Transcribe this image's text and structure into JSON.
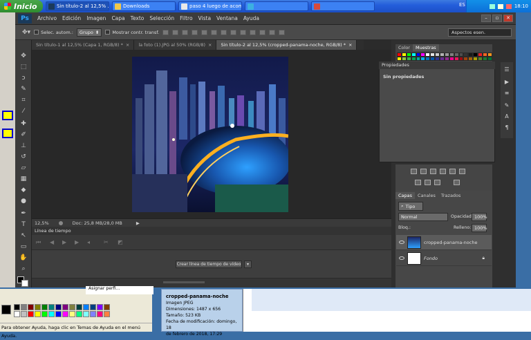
{
  "taskbar": {
    "start_label": "Inicio",
    "buttons": [
      {
        "label": "Sin título-2 al 12,5% ..."
      },
      {
        "label": "Downloads"
      },
      {
        "label": "paso 4 luego de acom..."
      },
      {
        "label": ""
      },
      {
        "label": ""
      }
    ],
    "lang": "ES",
    "time": "18:10"
  },
  "photoshop": {
    "logo": "Ps",
    "menu": [
      "Archivo",
      "Edición",
      "Imagen",
      "Capa",
      "Texto",
      "Selección",
      "Filtro",
      "Vista",
      "Ventana",
      "Ayuda"
    ],
    "options": {
      "auto_select_label": "Selec. autom.:",
      "group_value": "Grupo",
      "show_transform_label": "Mostrar contr. transf.",
      "workspace": "Aspectos esen."
    },
    "tabs": [
      "Sin título-1 al 12,5% (Capa 1, RGB/8) *",
      "la foto (1).JPG al 50% (RGB/8)",
      "Sin título-2 al 12,5% (cropped-panama-noche, RGB/8) *"
    ],
    "status": {
      "zoom": "12,5%",
      "doc_info": "Doc: 25,8 MB/28,0 MB"
    },
    "timeline": {
      "title": "Línea de tiempo",
      "create_button": "Crear línea de tiempo de vídeo"
    },
    "color_panel": {
      "tabs": [
        "Color",
        "Muestras"
      ],
      "swatch_colors": [
        "#ff0000",
        "#ffff00",
        "#00ff00",
        "#00ffff",
        "#0000ff",
        "#ff00ff",
        "#ffffff",
        "#e6e6e6",
        "#cccccc",
        "#b3b3b3",
        "#999999",
        "#808080",
        "#666666",
        "#4d4d4d",
        "#333333",
        "#1a1a1a",
        "#000000",
        "#ed1c24",
        "#f26522",
        "#f7941d",
        "#fff200",
        "#8dc63f",
        "#39b54a",
        "#00a651",
        "#00a99d",
        "#00aeef",
        "#0072bc",
        "#0054a6",
        "#2e3192",
        "#662d91",
        "#92278f",
        "#ec008c",
        "#ed145b",
        "#9e0b0f",
        "#a0410d",
        "#a3620a",
        "#aba000",
        "#598527",
        "#1a7b30",
        "#007236"
      ]
    },
    "properties": {
      "title": "Propiedades",
      "text": "Sin propiedades"
    },
    "layers": {
      "tabs": [
        "Capas",
        "Canales",
        "Trazados"
      ],
      "kind": "Tipo",
      "blend_mode": "Normal",
      "opacity_label": "Opacidad:",
      "opacity_value": "100%",
      "lock_label": "Bloq.:",
      "fill_label": "Relleno:",
      "fill_value": "100%",
      "items": [
        {
          "name": "cropped-panama-noche",
          "selected": true
        },
        {
          "name": "Fondo",
          "selected": false
        }
      ]
    }
  },
  "desktop": {
    "assign_text": "Asignar perfi...",
    "help_text": "Para obtener Ayuda, haga clic en Temas de Ayuda en el menú Ayuda.",
    "palette": [
      "#000000",
      "#808080",
      "#800000",
      "#808000",
      "#008000",
      "#008080",
      "#000080",
      "#800080",
      "#808040",
      "#004040",
      "#0080ff",
      "#004080",
      "#8000ff",
      "#804000",
      "#ffffff",
      "#c0c0c0",
      "#ff0000",
      "#ffff00",
      "#00ff00",
      "#00ffff",
      "#0000ff",
      "#ff00ff",
      "#ffff80",
      "#00ff80",
      "#80ffff",
      "#8080ff",
      "#ff0080",
      "#ff8040"
    ],
    "file_info": {
      "name": "cropped-panama-noche",
      "type": "Imagen JPEG",
      "dimensions": "Dimensiones: 1487 x 656",
      "size": "Tamaño: 523 KB",
      "modified": "Fecha de modificación: domingo, 18",
      "modified2": "de febrero de 2018, 17:29"
    }
  }
}
